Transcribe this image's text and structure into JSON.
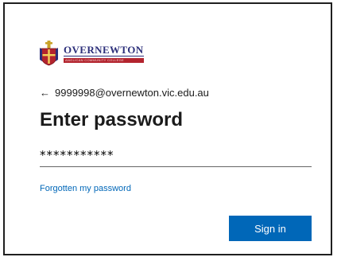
{
  "brand": {
    "name": "OVERNEWTON",
    "subtitle": "ANGLICAN COMMUNITY COLLEGE",
    "crest_icon": "school-crest-icon",
    "name_color": "#2c2f7a",
    "subtitle_bg": "#b3242e"
  },
  "identity": {
    "back_icon": "arrow-left-icon",
    "back_glyph": "←",
    "email": "9999998@overnewton.vic.edu.au"
  },
  "form": {
    "title": "Enter password",
    "password_value": "***********",
    "forgot_link": "Forgotten my password",
    "submit_label": "Sign in",
    "accent": "#0067b8"
  }
}
